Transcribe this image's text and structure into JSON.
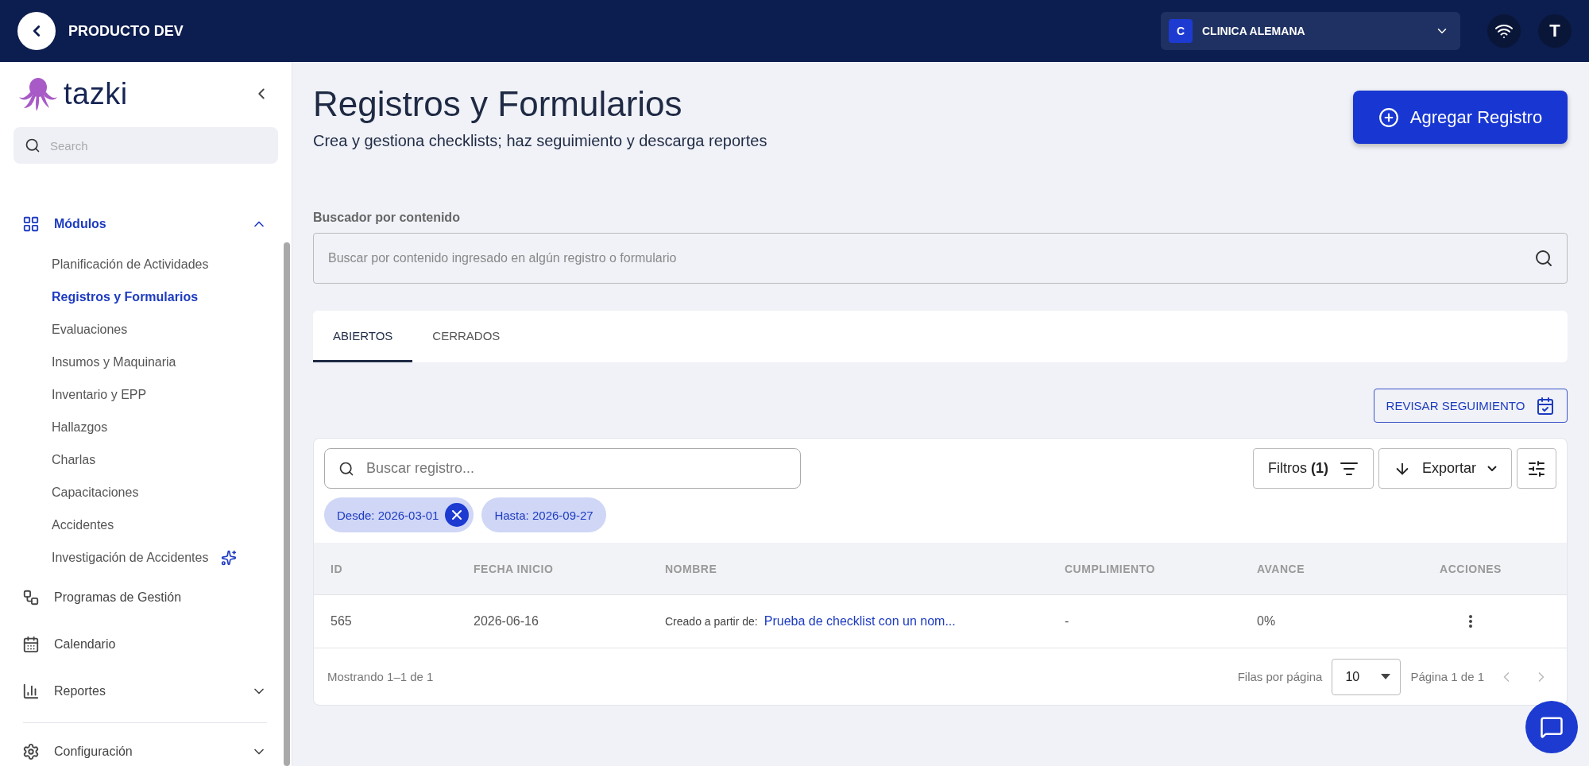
{
  "topbar": {
    "title": "PRODUCTO DEV",
    "company": {
      "initial": "C",
      "name": "CLINICA ALEMANA"
    },
    "avatar": "T"
  },
  "sidebar": {
    "logo": "tazki",
    "search": {
      "placeholder": "Search"
    },
    "nav": [
      {
        "label": "Módulos",
        "expanded": true,
        "active": true,
        "children": [
          {
            "label": "Planificación de Actividades",
            "selected": false,
            "sparkle": false
          },
          {
            "label": "Registros y Formularios",
            "selected": true,
            "sparkle": false
          },
          {
            "label": "Evaluaciones",
            "selected": false,
            "sparkle": false
          },
          {
            "label": "Insumos y Maquinaria",
            "selected": false,
            "sparkle": false
          },
          {
            "label": "Inventario y EPP",
            "selected": false,
            "sparkle": false
          },
          {
            "label": "Hallazgos",
            "selected": false,
            "sparkle": false
          },
          {
            "label": "Charlas",
            "selected": false,
            "sparkle": false
          },
          {
            "label": "Capacitaciones",
            "selected": false,
            "sparkle": false
          },
          {
            "label": "Accidentes",
            "selected": false,
            "sparkle": false
          },
          {
            "label": "Investigación de Accidentes",
            "selected": false,
            "sparkle": true
          }
        ]
      },
      {
        "label": "Programas de Gestión",
        "active": false
      },
      {
        "label": "Calendario",
        "active": false
      },
      {
        "label": "Reportes",
        "expanded": false,
        "active": false
      },
      {
        "label": "Configuración",
        "expanded": false,
        "active": false,
        "divider_before": true
      }
    ]
  },
  "page": {
    "title": "Registros y Formularios",
    "subtitle": "Crea y gestiona checklists; haz seguimiento y descarga reportes",
    "add_button": "Agregar Registro",
    "content_search": {
      "label": "Buscador por contenido",
      "placeholder": "Buscar por contenido ingresado en algún registro o formulario"
    },
    "tabs": [
      {
        "label": "ABIERTOS",
        "selected": true
      },
      {
        "label": "CERRADOS",
        "selected": false
      }
    ],
    "review_button": "REVISAR SEGUIMIENTO",
    "table": {
      "search": {
        "placeholder": "Buscar registro..."
      },
      "filters_button": "Filtros **(1)**",
      "export_button": "Exportar",
      "chips": [
        {
          "label": "Desde: 2026-03-01",
          "removable": true
        },
        {
          "label": "Hasta: 2026-09-27",
          "removable": false
        }
      ],
      "columns": [
        "ID",
        "FECHA INICIO",
        "NOMBRE",
        "CUMPLIMIENTO",
        "AVANCE",
        "ACCIONES"
      ],
      "rows": [
        {
          "id": "565",
          "start_date": "2026-06-16",
          "name_prefix": "Creado a partir de:",
          "name_link": "Prueba de checklist con un nom...",
          "compliance": "-",
          "progress": "0%"
        }
      ],
      "footer": {
        "showing": "Mostrando 1–1 de 1",
        "rows_per_page_label": "Filas por página",
        "rows_per_page": "10",
        "page": "Página 1 de 1",
        "prev_disabled": true,
        "next_disabled": true
      }
    }
  }
}
